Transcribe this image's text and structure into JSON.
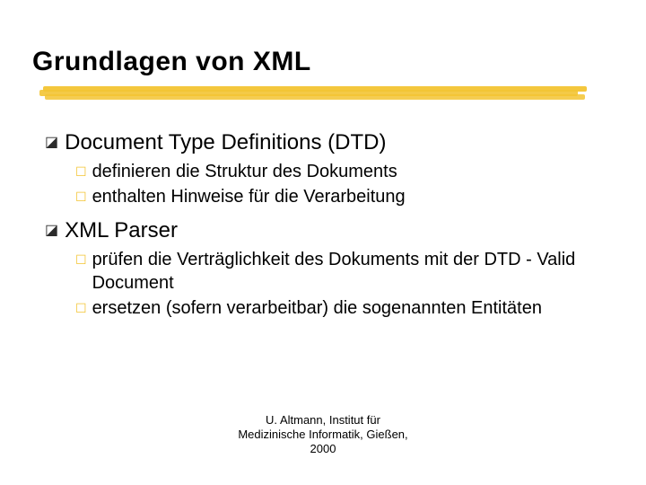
{
  "title": "Grundlagen von XML",
  "bullets": {
    "b1": {
      "label": "Document Type Definitions (DTD)",
      "sub": [
        "definieren die Struktur des Dokuments",
        "enthalten Hinweise für die Verarbeitung"
      ]
    },
    "b2": {
      "label": "XML Parser",
      "sub": [
        "prüfen die Verträglichkeit des Dokuments mit der DTD - Valid Document",
        "ersetzen (sofern verarbeitbar) die sogenannten Entitäten"
      ]
    }
  },
  "footer": {
    "l1": "U. Altmann, Institut für",
    "l2": "Medizinische Informatik, Gießen,",
    "l3": "2000"
  },
  "glyph": {
    "square_filled": "◪",
    "square_outline": "☐"
  }
}
